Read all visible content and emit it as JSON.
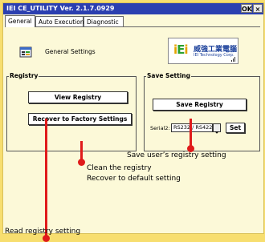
{
  "window": {
    "title": "IEI CE_UTILITY Ver. 2.1.7.0929",
    "ok_label": "OK",
    "close_label": "×"
  },
  "tabs": [
    {
      "label": "General",
      "active": true
    },
    {
      "label": "Auto Execution",
      "active": false
    },
    {
      "label": "Diagnostic",
      "active": false
    }
  ],
  "general": {
    "heading": "General Settings",
    "logo": {
      "brand_i": "i",
      "brand_e": "E",
      "brand_i2": "i",
      "chinese": "威強工業電腦",
      "english": "IEI Technology Corp."
    }
  },
  "registry": {
    "group_title": "Registry",
    "view_label": "View Registry",
    "recover_label": "Recover to Factory Settings"
  },
  "save_setting": {
    "group_title": "Save Setting",
    "save_label": "Save Registry",
    "serial_label": "Serial2:",
    "serial_value": "RS232 / RS422",
    "set_label": "Set"
  },
  "annotations": {
    "save": "Save user’s registry setting",
    "clean_line1": "Clean the registry",
    "clean_line2": "Recover to default setting",
    "read": "Read registry setting"
  },
  "colors": {
    "background": "#f7de6f",
    "panel": "#fcf9d8",
    "titlebar": "#2b3fb0",
    "annotation_red": "#e01b1b"
  }
}
